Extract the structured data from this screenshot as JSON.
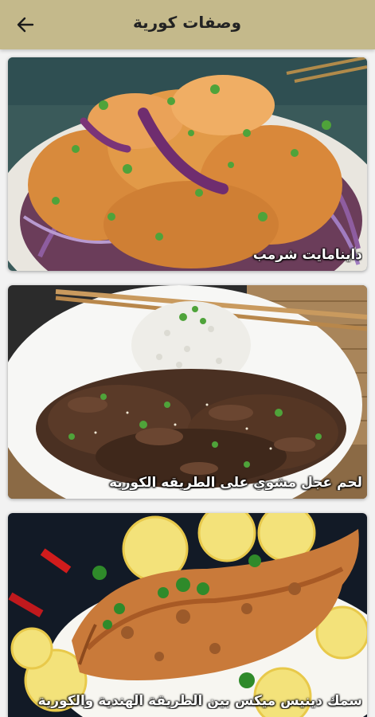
{
  "header": {
    "title": "وصفات كورية",
    "back_icon": "arrow-left-icon",
    "background": "#c4b98b"
  },
  "recipes": [
    {
      "title": "داينامايت شرمب"
    },
    {
      "title": "لحم عجل مشوي على الطريقه الكوريه"
    },
    {
      "title": "سمك دينيس ميكس بين الطريقة الهندية والكورية"
    }
  ]
}
